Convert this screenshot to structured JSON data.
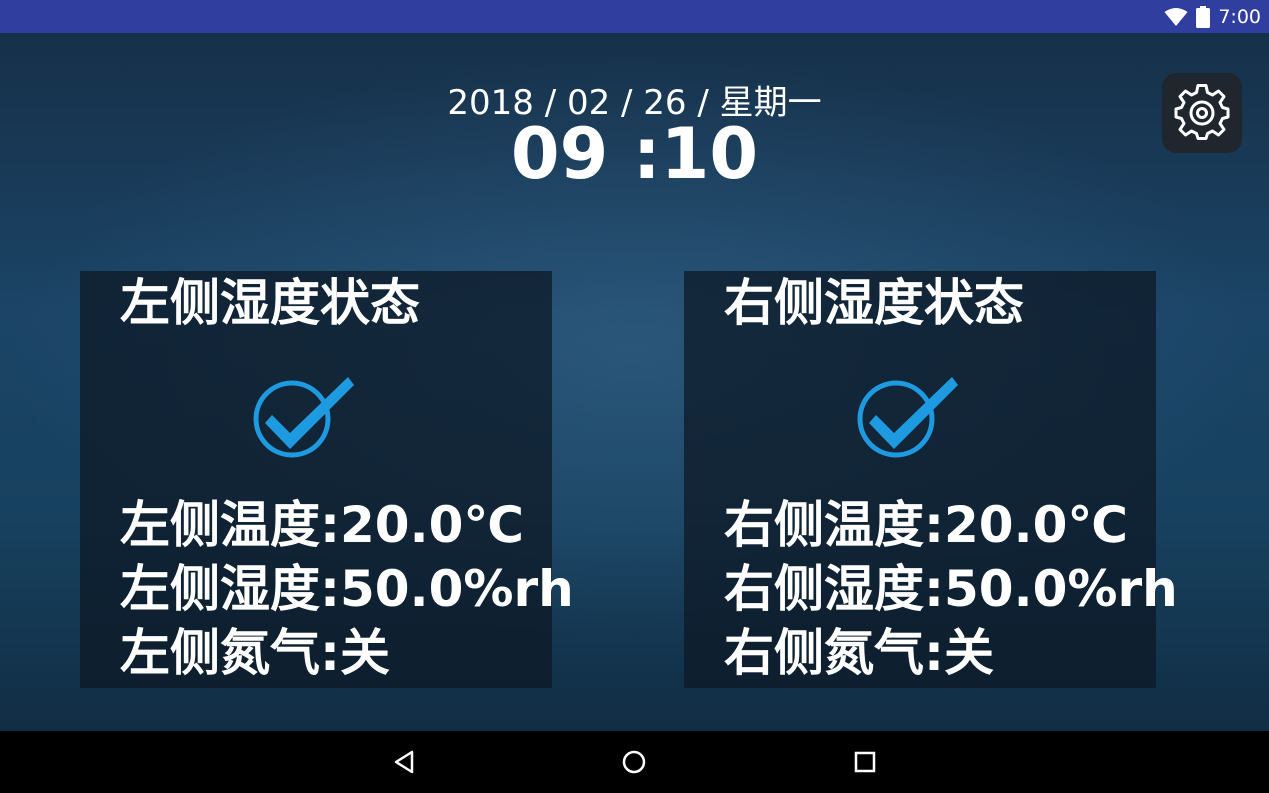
{
  "status_bar": {
    "time": "7:00",
    "icons": [
      "wifi-icon",
      "battery-icon"
    ],
    "background": "#303f9f"
  },
  "header": {
    "date": "2018 / 02 / 26 / 星期一",
    "time": "09 :10"
  },
  "settings": {
    "icon": "gear-icon"
  },
  "panels": {
    "left": {
      "title": "左侧湿度状态",
      "status_icon": "check-circle-icon",
      "temperature": "左侧温度:20.0℃",
      "humidity": "左侧湿度:50.0%rh",
      "nitrogen": "左侧氮气:关"
    },
    "right": {
      "title": "右侧湿度状态",
      "status_icon": "check-circle-icon",
      "temperature": "右侧温度:20.0℃",
      "humidity": "右侧湿度:50.0%rh",
      "nitrogen": "右侧氮气:关"
    }
  },
  "colors": {
    "accent": "#1e9be0",
    "text": "#ffffff"
  },
  "nav_bar": {
    "buttons": [
      "back-icon",
      "home-icon",
      "recent-apps-icon"
    ]
  }
}
